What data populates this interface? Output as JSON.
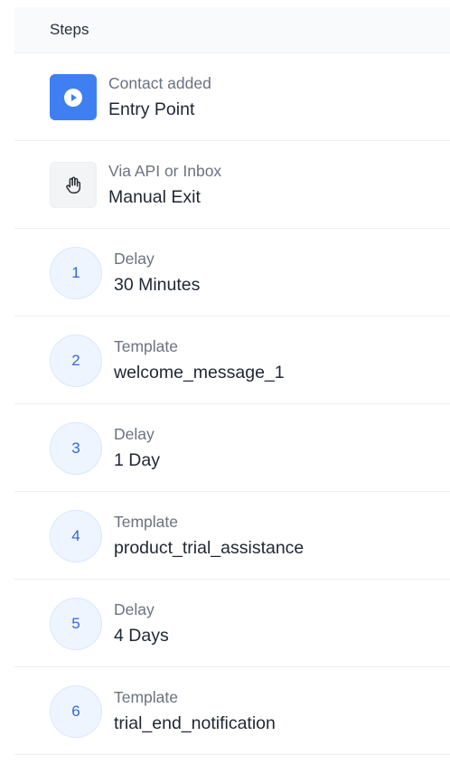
{
  "header": {
    "title": "Steps"
  },
  "entry": {
    "sub": "Contact added",
    "main": "Entry Point",
    "icon": "play-circle-icon",
    "color": "#3e7ff2"
  },
  "exit": {
    "sub": "Via API or Inbox",
    "main": "Manual Exit",
    "icon": "hand-stop-icon"
  },
  "steps": [
    {
      "num": "1",
      "sub": "Delay",
      "main": "30 Minutes"
    },
    {
      "num": "2",
      "sub": "Template",
      "main": "welcome_message_1"
    },
    {
      "num": "3",
      "sub": "Delay",
      "main": "1 Day"
    },
    {
      "num": "4",
      "sub": "Template",
      "main": "product_trial_assistance"
    },
    {
      "num": "5",
      "sub": "Delay",
      "main": "4 Days"
    },
    {
      "num": "6",
      "sub": "Template",
      "main": "trial_end_notification"
    }
  ]
}
